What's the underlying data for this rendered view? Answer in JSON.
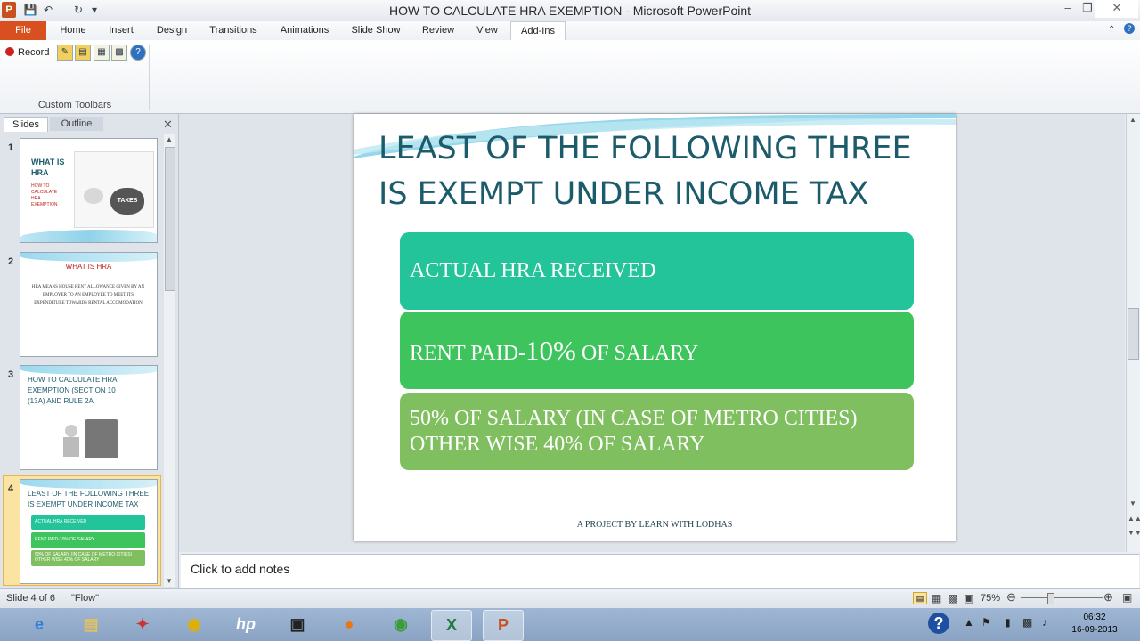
{
  "window": {
    "title": "HOW TO CALCULATE HRA EXEMPTION  -  Microsoft PowerPoint",
    "app_letter": "P"
  },
  "ribbon": {
    "tabs": [
      "File",
      "Home",
      "Insert",
      "Design",
      "Transitions",
      "Animations",
      "Slide Show",
      "Review",
      "View",
      "Add-Ins"
    ],
    "active_tab": "Add-Ins",
    "record_label": "Record",
    "group_label": "Custom Toolbars"
  },
  "pane": {
    "tab_slides": "Slides",
    "tab_outline": "Outline",
    "selected_slide": 4
  },
  "thumbnails": [
    {
      "num": "1",
      "title": "WHAT IS HRA",
      "subtitle": "HOW TO CALCULATE HRA EXEMPTION",
      "image_label": "TAXES"
    },
    {
      "num": "2",
      "title": "WHAT IS HRA",
      "body": "HRA MEANS HOUSE RENT ALLOWANCE GIVEN BY AN EMPLOYER TO AN EMPLOYEE TO MEET ITS EXPENDITURE TOWARDS RENTAL ACCOMODATION"
    },
    {
      "num": "3",
      "title": "HOW TO CALCULATE HRA EXEMPTION  (SECTION 10 (13A) AND RULE 2A"
    },
    {
      "num": "4",
      "title": "LEAST OF THE FOLLOWING THREE IS EXEMPT UNDER INCOME TAX"
    }
  ],
  "slide": {
    "title_line1": "LEAST OF THE FOLLOWING THREE",
    "title_line2": "IS EXEMPT UNDER INCOME TAX",
    "box1": "ACTUAL HRA RECEIVED",
    "box2_pre": "RENT PAID-",
    "box2_big": "10%",
    "box2_post": " OF SALARY",
    "box3_line1": "50% OF SALARY (IN CASE OF METRO CITIES)",
    "box3_line2": "OTHER WISE 40% OF SALARY",
    "footer": "A PROJECT BY LEARN WITH LODHAS",
    "colors": {
      "title": "#1c5b6b",
      "box1": "#23c49a",
      "box2": "#3ec45d",
      "box3": "#7fbf5f"
    }
  },
  "notes": {
    "placeholder": "Click to add notes"
  },
  "status": {
    "slide_info": "Slide 4 of 6",
    "theme": "\"Flow\"",
    "zoom": "75%"
  },
  "taskbar": {
    "time": "06:32",
    "date": "16-09-2013"
  }
}
